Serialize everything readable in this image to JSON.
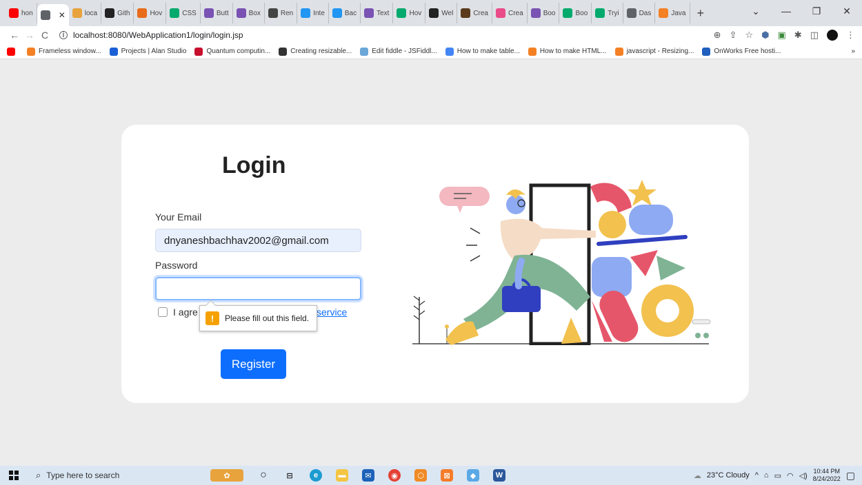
{
  "browser": {
    "tabs": [
      {
        "label": "hon",
        "icon": "youtube-icon",
        "color": "#ff0000"
      },
      {
        "label": "",
        "icon": "globe-icon",
        "color": "#5f6368",
        "active": true
      },
      {
        "label": "loca",
        "icon": "chart-icon",
        "color": "#e8a33d"
      },
      {
        "label": "Gith",
        "icon": "github-icon",
        "color": "#222222"
      },
      {
        "label": "Hov",
        "icon": "bootstrap-icon",
        "color": "#e86c1a"
      },
      {
        "label": "CSS",
        "icon": "w3schools-icon",
        "color": "#04aa6d"
      },
      {
        "label": "Butt",
        "icon": "bootstrap-icon",
        "color": "#7952b3"
      },
      {
        "label": "Box",
        "icon": "bootstrap-icon",
        "color": "#7952b3"
      },
      {
        "label": "Ren",
        "icon": "diamond-icon",
        "color": "#444444"
      },
      {
        "label": "Inte",
        "icon": "is-icon",
        "color": "#2196f3"
      },
      {
        "label": "Bac",
        "icon": "is-icon",
        "color": "#2196f3"
      },
      {
        "label": "Text",
        "icon": "bootstrap-icon",
        "color": "#7952b3"
      },
      {
        "label": "Hov",
        "icon": "w3schools-icon",
        "color": "#04aa6d"
      },
      {
        "label": "Wel",
        "icon": "webflow-icon",
        "color": "#222222"
      },
      {
        "label": "Crea",
        "icon": "book-icon",
        "color": "#5a3a1a"
      },
      {
        "label": "Crea",
        "icon": "dribbble-icon",
        "color": "#ea4c89"
      },
      {
        "label": "Boo",
        "icon": "bootstrap-icon",
        "color": "#7952b3"
      },
      {
        "label": "Boo",
        "icon": "w3schools-icon",
        "color": "#04aa6d"
      },
      {
        "label": "Tryi",
        "icon": "w3schools-icon",
        "color": "#04aa6d"
      },
      {
        "label": "Das",
        "icon": "globe-icon",
        "color": "#5f6368"
      },
      {
        "label": "Java",
        "icon": "stackoverflow-icon",
        "color": "#f48024"
      }
    ],
    "url": "localhost:8080/WebApplication1/login/login.jsp",
    "bookmarks": [
      {
        "label": "",
        "color": "#ff0000"
      },
      {
        "label": "Frameless window...",
        "color": "#f48024"
      },
      {
        "label": "Projects | Alan Studio",
        "color": "#1a5fd6"
      },
      {
        "label": "Quantum computin...",
        "color": "#c8102e"
      },
      {
        "label": "Creating resizable...",
        "color": "#333333"
      },
      {
        "label": "Edit fiddle - JSFiddl...",
        "color": "#6aa6d8"
      },
      {
        "label": "How to make table...",
        "color": "#4285f4"
      },
      {
        "label": "How to make HTML...",
        "color": "#f48024"
      },
      {
        "label": "javascript - Resizing...",
        "color": "#f48024"
      },
      {
        "label": "OnWorks Free hosti...",
        "color": "#1e5fbf"
      }
    ],
    "bookmarks_more": "»"
  },
  "login": {
    "title": "Login",
    "email_label": "Your Email",
    "email_value": "dnyaneshbachhav2002@gmail.com",
    "password_label": "Password",
    "agree_text": "I agre",
    "tos_text": "service",
    "tooltip_text": "Please fill out this field.",
    "tooltip_icon": "!",
    "register_label": "Register"
  },
  "taskbar": {
    "search_placeholder": "Type here to search",
    "weather": "23°C  Cloudy",
    "time": "10:44 PM",
    "date": "8/24/2022"
  }
}
